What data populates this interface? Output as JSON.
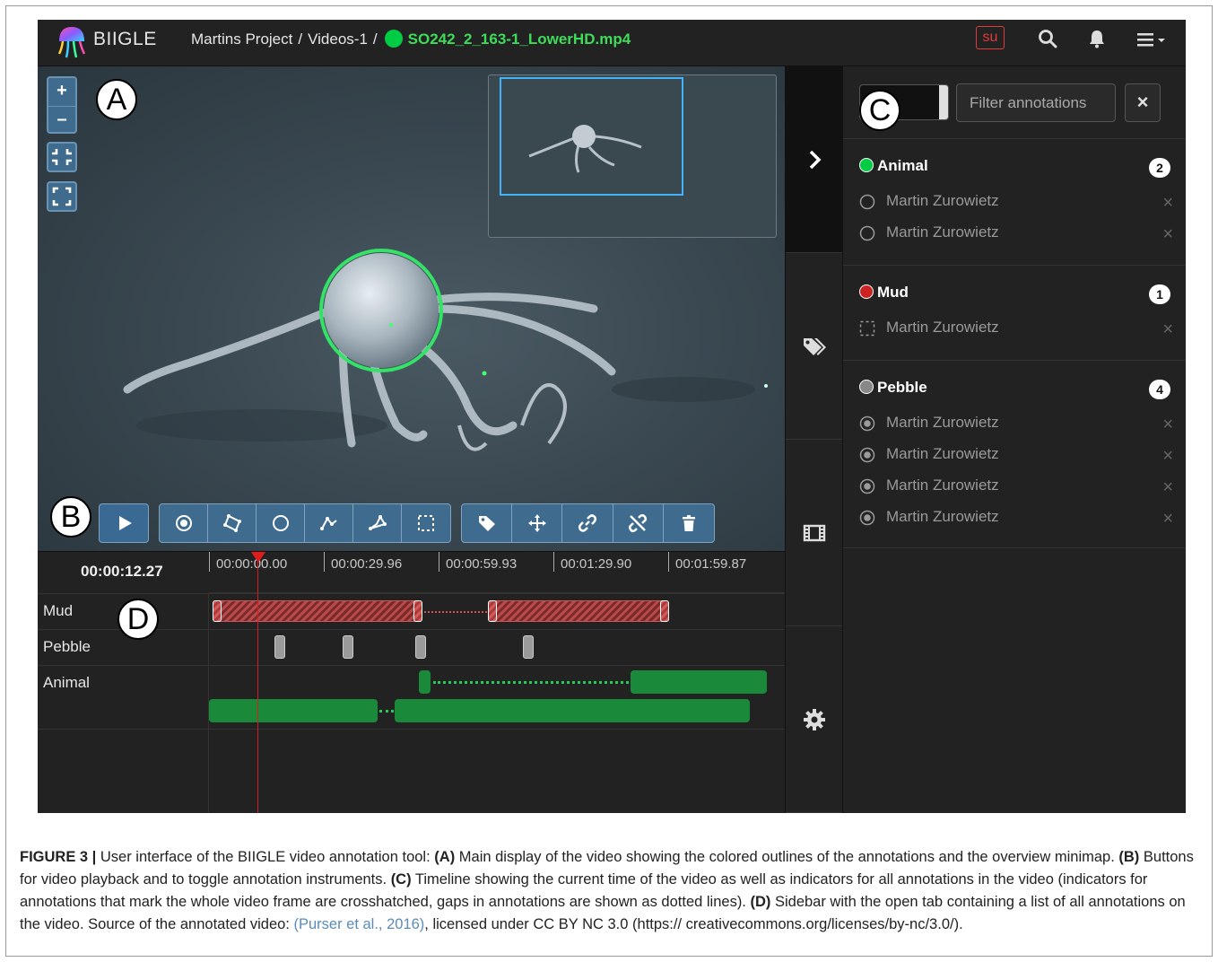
{
  "app": {
    "brand": "BIIGLE",
    "breadcrumb_project": "Martins Project",
    "breadcrumb_volume": "Videos-1",
    "breadcrumb_sep": "/",
    "file_name": "SO242_2_163-1_LowerHD.mp4",
    "file_color": "#00cc44",
    "user_badge": "su"
  },
  "nav_icons": [
    "search-icon",
    "bell-icon",
    "menu-icon"
  ],
  "video": {
    "zoom_in": "+",
    "zoom_out": "–"
  },
  "panel_letters": {
    "a": "A",
    "b": "B",
    "c": "C",
    "d": "D"
  },
  "timeline": {
    "current_time": "00:00:12.27",
    "ticks": [
      "00:00:00.00",
      "00:00:29.96",
      "00:00:59.93",
      "00:01:29.90",
      "00:01:59.87"
    ],
    "tracks": [
      "Mud",
      "Pebble",
      "Animal"
    ]
  },
  "sidebar": {
    "filter_placeholder": "Filter annotations",
    "clear_label": "×",
    "groups": [
      {
        "label": "Animal",
        "color": "#00cc44",
        "count": "2",
        "annotations": [
          {
            "shape": "circle",
            "user": "Martin Zurowietz"
          },
          {
            "shape": "circle",
            "user": "Martin Zurowietz"
          }
        ]
      },
      {
        "label": "Mud",
        "color": "#cc2222",
        "count": "1",
        "annotations": [
          {
            "shape": "wholeframe",
            "user": "Martin Zurowietz"
          }
        ]
      },
      {
        "label": "Pebble",
        "color": "#888888",
        "count": "4",
        "annotations": [
          {
            "shape": "point",
            "user": "Martin Zurowietz"
          },
          {
            "shape": "point",
            "user": "Martin Zurowietz"
          },
          {
            "shape": "point",
            "user": "Martin Zurowietz"
          },
          {
            "shape": "point",
            "user": "Martin Zurowietz"
          }
        ]
      }
    ],
    "delete_label": "×"
  },
  "caption": {
    "fig_label": "FIGURE 3 |",
    "intro": " User interface of the BIIGLE video annotation tool: ",
    "a_label": "(A)",
    "a_text": " Main display of the video showing the colored outlines of the annotations and the overview minimap. ",
    "b_label": "(B)",
    "b_text": " Buttons for video playback and to toggle annotation instruments. ",
    "c_label": "(C)",
    "c_text": " Timeline showing the current time of the video as well as indicators for all annotations in the video (indicators for annotations that mark the whole video frame are crosshatched, gaps in annotations are shown as dotted lines). ",
    "d_label": "(D)",
    "d_text": " Sidebar with the open tab containing a list of all annotations on the video. Source of the annotated video: ",
    "citation": "(Purser et al., 2016)",
    "license": ", licensed under CC BY NC 3.0 (https:// creativecommons.org/licenses/by-nc/3.0/)."
  }
}
